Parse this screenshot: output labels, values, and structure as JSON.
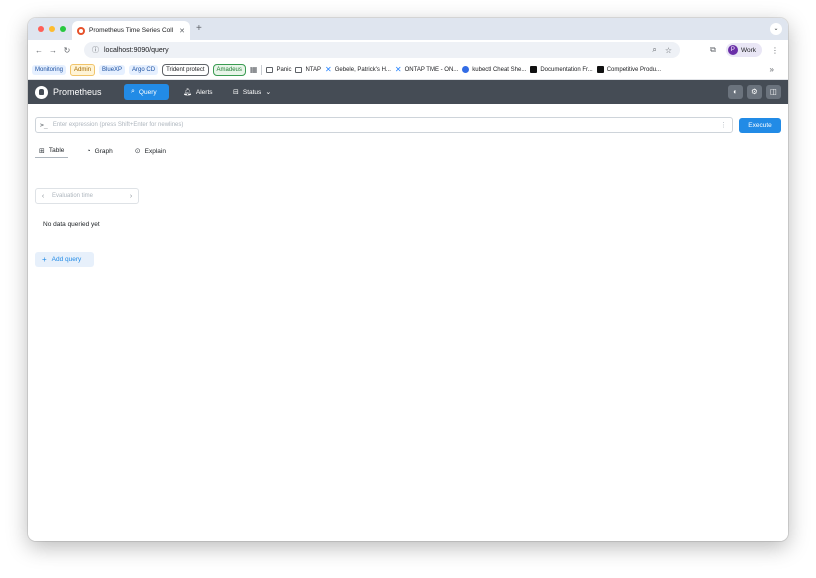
{
  "browser": {
    "tab_title": "Prometheus Time Series Coll",
    "tab_close": "✕",
    "new_tab": "+",
    "tab_menu": "⌄",
    "url": "localhost:9090/query",
    "profile_initial": "P",
    "profile_name": "Work",
    "icons": {
      "back": "back-arrow-icon",
      "forward": "forward-arrow-icon",
      "reload": "reload-icon",
      "site_info": "site-info-icon",
      "zoom": "zoom-icon",
      "bookmark": "star-icon",
      "extensions": "extensions-icon",
      "menu": "kebab-menu-icon"
    }
  },
  "bookmarks": {
    "chips": [
      {
        "label": "Monitoring",
        "color": "#1a4fa0"
      },
      {
        "label": "Admin",
        "color": "#a46800"
      },
      {
        "label": "BlueXP",
        "color": "#1a4fa0"
      },
      {
        "label": "Argo CD",
        "color": "#1a4fa0"
      },
      {
        "label": "Trident protect",
        "color": "#202124"
      },
      {
        "label": "Amadeus",
        "color": "#1e7e34"
      }
    ],
    "items": [
      {
        "label": "Panic",
        "icon": "folder-icon"
      },
      {
        "label": "NTAP",
        "icon": "folder-icon"
      },
      {
        "label": "Gebele, Patrick's H...",
        "icon": "confluence-icon"
      },
      {
        "label": "ONTAP TME - ON...",
        "icon": "confluence-icon"
      },
      {
        "label": "kubectl Cheat She...",
        "icon": "kubernetes-icon"
      },
      {
        "label": "Documentation Fr...",
        "icon": "notion-icon"
      },
      {
        "label": "Competitive Produ...",
        "icon": "notion-icon"
      }
    ],
    "more": "»"
  },
  "prometheus": {
    "app_title": "Prometheus",
    "nav": {
      "query": "Query",
      "alerts": "Alerts",
      "status": "Status"
    },
    "accent_color": "#228be6",
    "header_color": "#454c55",
    "expression": {
      "placeholder": "Enter expression (press Shift+Enter for newlines)",
      "value": ""
    },
    "execute_label": "Execute",
    "view_tabs": {
      "table": "Table",
      "graph": "Graph",
      "explain": "Explain"
    },
    "eval_time_placeholder": "Evaluation time",
    "no_data_text": "No data queried yet",
    "add_query_label": "Add query"
  }
}
